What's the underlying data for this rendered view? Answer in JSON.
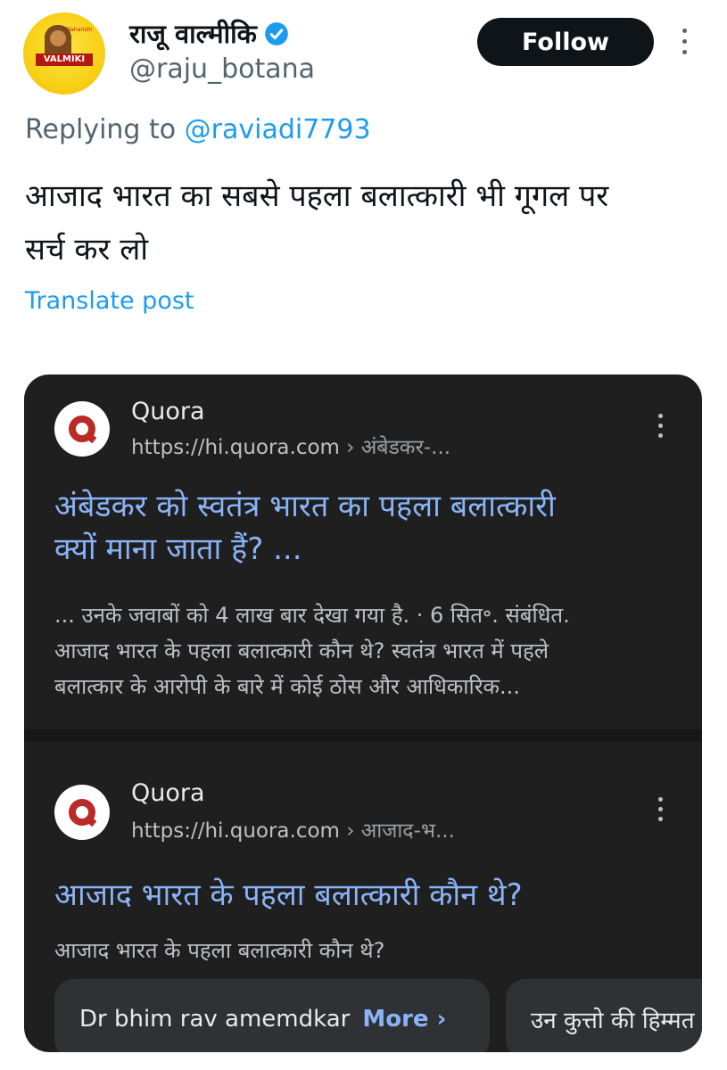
{
  "post": {
    "author_name": "राजू वाल्मीकि",
    "handle": "@raju_botana",
    "follow_label": "Follow",
    "replying_prefix": "Replying to ",
    "replying_handle": "@raviadi7793",
    "text_line1": "आजाद भारत का सबसे पहला बलात्कारी भी गूगल पर",
    "text_line2": "सर्च कर लो",
    "translate_label": "Translate post",
    "avatar_banner": "VALMIKI",
    "avatar_small": "Maharishi",
    "verified_color": "#1d9bf0"
  },
  "embedded_screenshot": {
    "results": [
      {
        "site": "Quora",
        "url": "https://hi.quora.com",
        "breadcrumb": " › अंबेडकर-...",
        "title_line1": "अंबेडकर को स्वतंत्र भारत का पहला बलात्कारी",
        "title_line2": "क्यों माना जाता हैं? ...",
        "snippet_line1": "... उनके जवाबों को 4 लाख बार देखा गया है. · 6 सित॰. संबंधित.",
        "snippet_line2": "आजाद भारत के पहला बलात्कारी कौन थे? स्वतंत्र भारत में पहले",
        "snippet_line3": "बलात्कार के आरोपी के बारे में कोई ठोस और आधिकारिक..."
      },
      {
        "site": "Quora",
        "url": "https://hi.quora.com",
        "breadcrumb": " › आजाद-भ...",
        "title_line1": "आजाद भारत के पहला बलात्कारी कौन थे?",
        "snippet_line1": "आजाद भारत के पहला बलात्कारी कौन थे?",
        "chips": [
          {
            "text": "Dr bhim rav amemdkar",
            "more": "More ›"
          },
          {
            "text": "उन कुत्तो की हिम्मत"
          }
        ]
      }
    ],
    "colors": {
      "card_bg": "#1f1f1f",
      "title": "#8ab4f8",
      "snippet": "#bdc1c6",
      "quora_red": "#b92b27"
    }
  }
}
